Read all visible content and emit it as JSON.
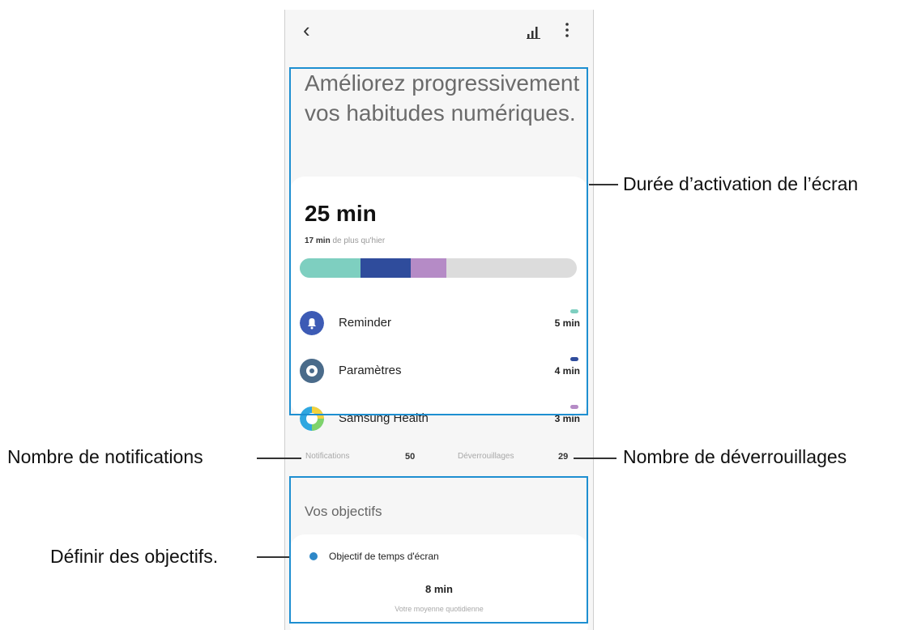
{
  "screen": {
    "back_icon": "chevron-left-icon",
    "stats_icon": "bar-chart-icon",
    "more_icon": "more-vertical-icon",
    "headline": "Améliorez progressivement vos habitudes numériques.",
    "screen_time": {
      "total": "25 min",
      "delta_value": "17 min",
      "delta_text": "de plus qu'hier",
      "usage_bar": [
        {
          "app": "Reminder",
          "fraction": 0.22,
          "color": "#7ecfc0"
        },
        {
          "app": "Paramètres",
          "fraction": 0.18,
          "color": "#2f4c9c"
        },
        {
          "app": "Samsung Health",
          "fraction": 0.13,
          "color": "#b58bc6"
        }
      ]
    },
    "apps": [
      {
        "name": "Reminder",
        "time": "5 min",
        "color": "#7ecfc0",
        "icon": "bell-icon"
      },
      {
        "name": "Paramètres",
        "time": "4 min",
        "color": "#2f4c9c",
        "icon": "gear-icon"
      },
      {
        "name": "Samsung Health",
        "time": "3 min",
        "color": "#b58bc6",
        "icon": "samsung-health-icon"
      }
    ],
    "counts": {
      "notifications_label": "Notifications",
      "notifications_value": "50",
      "unlocks_label": "Déverrouillages",
      "unlocks_value": "29"
    },
    "goals": {
      "title": "Vos objectifs",
      "goal_label": "Objectif de temps d'écran",
      "goal_value": "8 min",
      "goal_sub": "Votre moyenne quotidienne"
    }
  },
  "callouts": {
    "screen_time": "Durée d’activation de l’écran",
    "notifications": "Nombre de notifications",
    "unlocks": "Nombre de déverrouillages",
    "goals": "Définir des objectifs."
  },
  "colors": {
    "highlight": "#1e8fd1",
    "accent": "#2d87c7"
  }
}
